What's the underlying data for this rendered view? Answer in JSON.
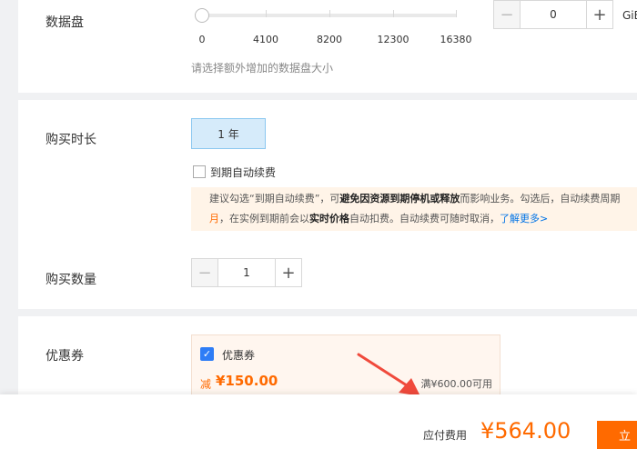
{
  "disk": {
    "label": "数据盘",
    "ticks": [
      "0",
      "4100",
      "8200",
      "12300",
      "16380"
    ],
    "hint": "请选择额外增加的数据盘大小",
    "stepper_value": "0",
    "unit": "GiB"
  },
  "duration": {
    "label": "购买时长",
    "year_option": "1 年",
    "auto_renew_label": "到期自动续费",
    "notice": {
      "p1": "建议勾选“到期自动续费”，可",
      "b1": "避免因资源到期停机或释放",
      "p2": "而影响业务。勾选后，自动续费周期",
      "o1": "月",
      "p3": "，在实例到期前会以",
      "b2": "实时价格",
      "p4": "自动扣费。自动续费可随时取消，",
      "link": "了解更多>"
    }
  },
  "quantity": {
    "label": "购买数量",
    "value": "1"
  },
  "coupon": {
    "label": "优惠券",
    "title": "优惠券",
    "minus_text": "减",
    "amount": "¥150.00",
    "condition": "满¥600.00可用"
  },
  "footer": {
    "pay_label": "应付费用",
    "pay_amount": "¥564.00",
    "buy_label": "立"
  },
  "colors": {
    "accent": "#ff6a00",
    "selected_bg": "#d6ebfa",
    "link": "#0073e6",
    "annotation_arrow": "#f04a3c"
  }
}
